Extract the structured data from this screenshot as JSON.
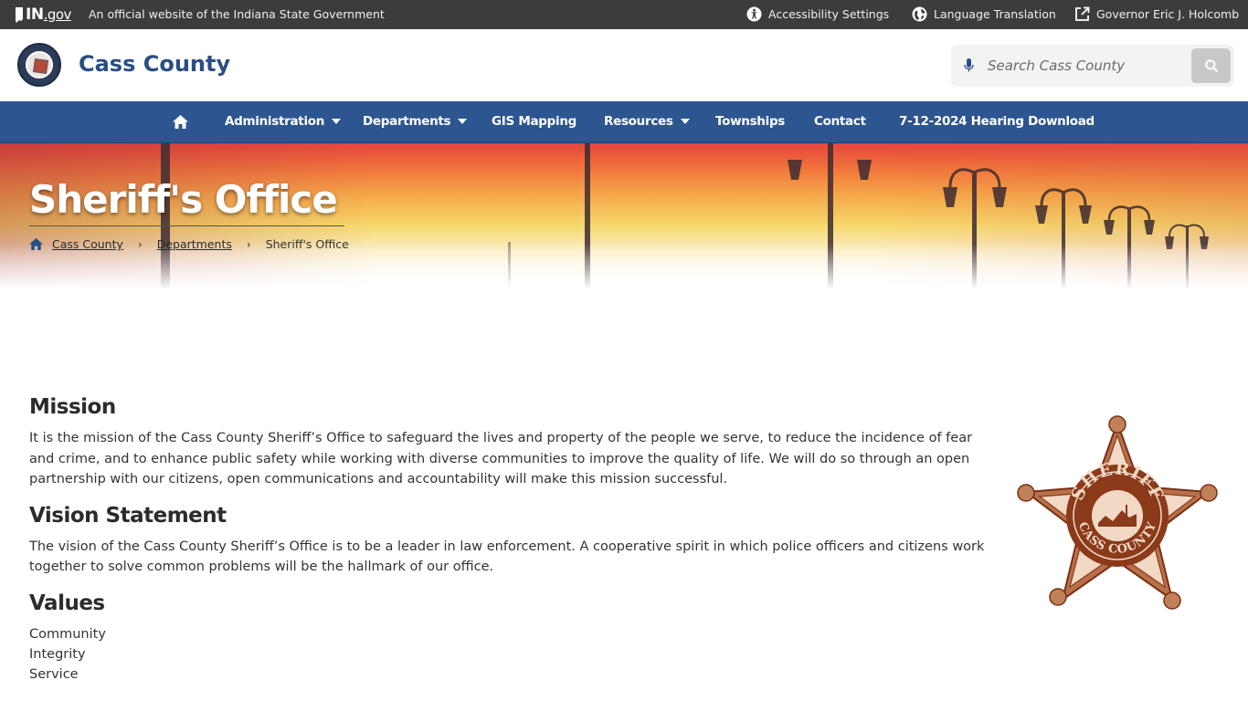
{
  "topbar": {
    "ingov_text": "IN",
    "ingov_suffix": ".gov",
    "official_text": "An official website of the Indiana State Government",
    "accessibility": "Accessibility Settings",
    "language": "Language Translation",
    "governor": "Governor Eric J. Holcomb"
  },
  "header": {
    "site_title": "Cass County",
    "search_placeholder": "Search Cass County"
  },
  "nav": {
    "items": [
      {
        "label": "Administration",
        "dropdown": true
      },
      {
        "label": "Departments",
        "dropdown": true
      },
      {
        "label": "GIS Mapping",
        "dropdown": false
      },
      {
        "label": "Resources",
        "dropdown": true
      },
      {
        "label": "Townships",
        "dropdown": false
      },
      {
        "label": "Contact",
        "dropdown": false
      },
      {
        "label": "7-12-2024 Hearing Download",
        "dropdown": false
      }
    ]
  },
  "hero": {
    "title": "Sheriff's Office",
    "breadcrumb": {
      "home": "Cass County",
      "level2": "Departments",
      "current": "Sheriff's Office"
    }
  },
  "content": {
    "mission_heading": "Mission",
    "mission_text": "It is the mission of the Cass County Sheriff’s Office to safeguard the lives and property of the people we serve, to reduce the incidence of fear and crime, and to enhance public safety while working with diverse communities to improve the quality of life. We will do so through an open partnership with our citizens, open communications and accountability will make this mission successful.",
    "vision_heading": "Vision Statement",
    "vision_text": "The vision of the Cass County Sheriff’s Office is to be a leader in law enforcement. A cooperative spirit in which police officers and citizens work together to solve common problems will be the hallmark of our office.",
    "values_heading": "Values",
    "values": [
      "Community",
      "Integrity",
      "Service"
    ]
  },
  "badge": {
    "top_text": "SHERIFF",
    "bottom_text": "CASS COUNTY",
    "color": "#8b3a1a"
  },
  "colors": {
    "topbar": "#3c3c3c",
    "nav": "#2d5590",
    "title": "#2a4d86"
  }
}
